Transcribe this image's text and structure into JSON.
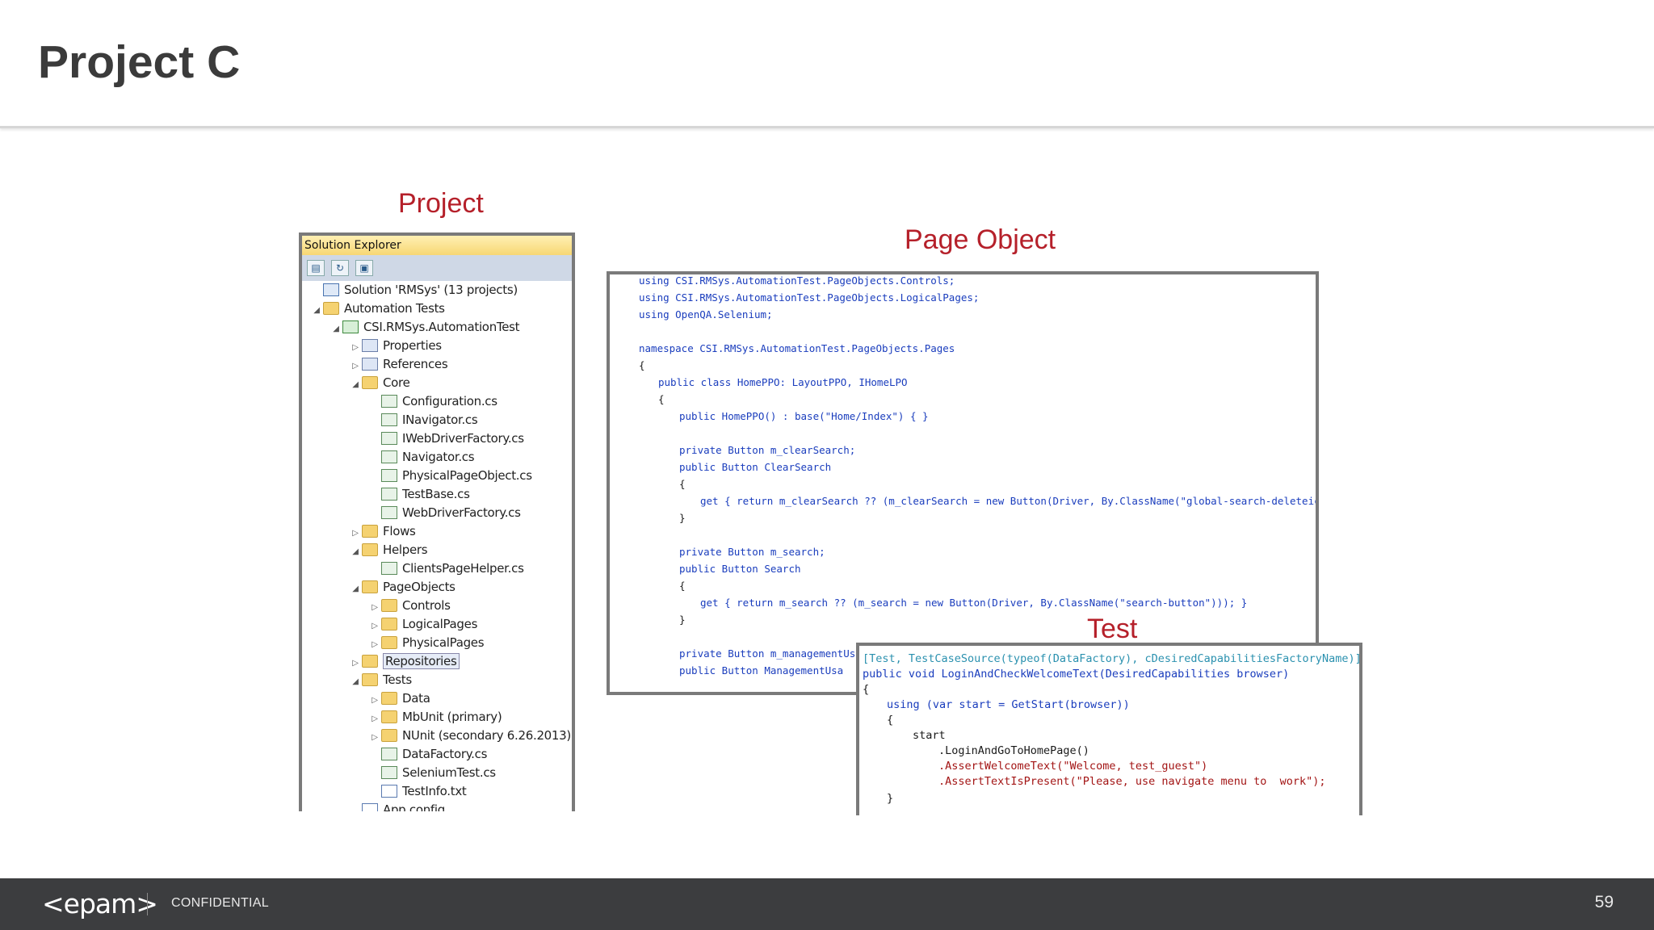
{
  "slide": {
    "title": "Project C",
    "page_number": "59"
  },
  "labels": {
    "project": "Project",
    "page_object": "Page Object",
    "test": "Test"
  },
  "solution_explorer": {
    "header": "Solution Explorer",
    "items": [
      {
        "label": "Solution 'RMSys' (13 projects)",
        "icon": "solution-icon"
      },
      {
        "label": "Automation Tests",
        "icon": "folder-icon"
      },
      {
        "label": "CSI.RMSys.AutomationTest",
        "icon": "project-icon"
      },
      {
        "label": "Properties",
        "icon": "properties-icon"
      },
      {
        "label": "References",
        "icon": "references-icon"
      },
      {
        "label": "Core",
        "icon": "folder-icon"
      },
      {
        "label": "Configuration.cs",
        "icon": "cs-file-icon"
      },
      {
        "label": "INavigator.cs",
        "icon": "cs-file-icon"
      },
      {
        "label": "IWebDriverFactory.cs",
        "icon": "cs-file-icon"
      },
      {
        "label": "Navigator.cs",
        "icon": "cs-file-icon"
      },
      {
        "label": "PhysicalPageObject.cs",
        "icon": "cs-file-icon"
      },
      {
        "label": "TestBase.cs",
        "icon": "cs-file-icon"
      },
      {
        "label": "WebDriverFactory.cs",
        "icon": "cs-file-icon"
      },
      {
        "label": "Flows",
        "icon": "folder-icon"
      },
      {
        "label": "Helpers",
        "icon": "folder-icon"
      },
      {
        "label": "ClientsPageHelper.cs",
        "icon": "cs-file-icon"
      },
      {
        "label": "PageObjects",
        "icon": "folder-icon"
      },
      {
        "label": "Controls",
        "icon": "folder-icon"
      },
      {
        "label": "LogicalPages",
        "icon": "folder-icon"
      },
      {
        "label": "PhysicalPages",
        "icon": "folder-icon"
      },
      {
        "label": "Repositories",
        "icon": "folder-icon"
      },
      {
        "label": "Tests",
        "icon": "folder-icon"
      },
      {
        "label": "Data",
        "icon": "folder-icon"
      },
      {
        "label": "MbUnit (primary)",
        "icon": "folder-icon"
      },
      {
        "label": "NUnit (secondary 6.26.2013)",
        "icon": "folder-icon"
      },
      {
        "label": "DataFactory.cs",
        "icon": "cs-file-icon"
      },
      {
        "label": "SeleniumTest.cs",
        "icon": "cs-file-icon"
      },
      {
        "label": "TestInfo.txt",
        "icon": "text-file-icon"
      },
      {
        "label": "App.config",
        "icon": "config-file-icon"
      }
    ]
  },
  "page_object_code": [
    "using CSI.RMSys.AutomationTest.PageObjects.Controls;",
    "using CSI.RMSys.AutomationTest.PageObjects.LogicalPages;",
    "using OpenQA.Selenium;",
    "namespace CSI.RMSys.AutomationTest.PageObjects.Pages",
    "{",
    "public class HomePPO: LayoutPPO, IHomeLPO",
    "{",
    "public HomePPO() : base(\"Home/Index\") { }",
    "private Button m_clearSearch;",
    "public Button ClearSearch",
    "{",
    "get { return m_clearSearch ?? (m_clearSearch = new Button(Driver, By.ClassName(\"global-search-deleteicon\"))); }",
    "}",
    "private Button m_search;",
    "public Button Search",
    "{",
    "get { return m_search ?? (m_search = new Button(Driver, By.ClassName(\"search-button\"))); }",
    "}",
    "private Button m_managementUsa;",
    "public Button ManagementUsa"
  ],
  "test_code": [
    "[Test, TestCaseSource(typeof(DataFactory), cDesiredCapabilitiesFactoryName)]",
    "public void LoginAndCheckWelcomeText(DesiredCapabilities browser)",
    "{",
    "using (var start = GetStart(browser))",
    "{",
    "start",
    ".LoginAndGoToHomePage()",
    ".AssertWelcomeText(\"Welcome, test_guest\")",
    ".AssertTextIsPresent(\"Please, use navigate menu to  work\");",
    "}"
  ],
  "footer": {
    "logo": "<epam>",
    "confidential": "CONFIDENTIAL"
  }
}
